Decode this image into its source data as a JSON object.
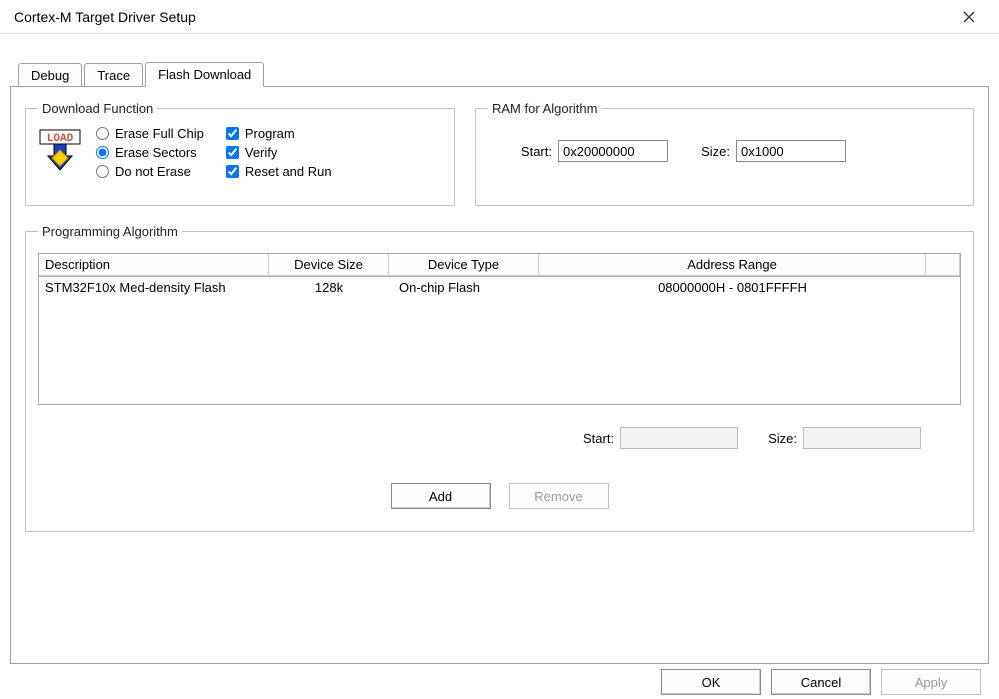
{
  "window": {
    "title": "Cortex-M Target Driver Setup"
  },
  "tabs": [
    {
      "label": "Debug",
      "active": false
    },
    {
      "label": "Trace",
      "active": false
    },
    {
      "label": "Flash Download",
      "active": true
    }
  ],
  "download_function": {
    "legend": "Download Function",
    "icon_caption": "LOAD",
    "radios": {
      "erase_full_chip": {
        "label": "Erase Full Chip",
        "checked": false
      },
      "erase_sectors": {
        "label": "Erase Sectors",
        "checked": true
      },
      "do_not_erase": {
        "label": "Do not Erase",
        "checked": false
      }
    },
    "checks": {
      "program": {
        "label": "Program",
        "checked": true
      },
      "verify": {
        "label": "Verify",
        "checked": true
      },
      "reset_and_run": {
        "label": "Reset and Run",
        "checked": true
      }
    }
  },
  "ram_for_algorithm": {
    "legend": "RAM for Algorithm",
    "start_label": "Start:",
    "start_value": "0x20000000",
    "size_label": "Size:",
    "size_value": "0x1000"
  },
  "programming_algorithm": {
    "legend": "Programming Algorithm",
    "columns": {
      "description": "Description",
      "device_size": "Device Size",
      "device_type": "Device Type",
      "address_range": "Address Range"
    },
    "rows": [
      {
        "description": "STM32F10x Med-density Flash",
        "device_size": "128k",
        "device_type": "On-chip Flash",
        "address_range": "08000000H - 0801FFFFH"
      }
    ],
    "start_label": "Start:",
    "start_value": "",
    "size_label": "Size:",
    "size_value": "",
    "buttons": {
      "add": "Add",
      "remove": "Remove"
    }
  },
  "dialog_buttons": {
    "ok": "OK",
    "cancel": "Cancel",
    "apply": "Apply"
  }
}
